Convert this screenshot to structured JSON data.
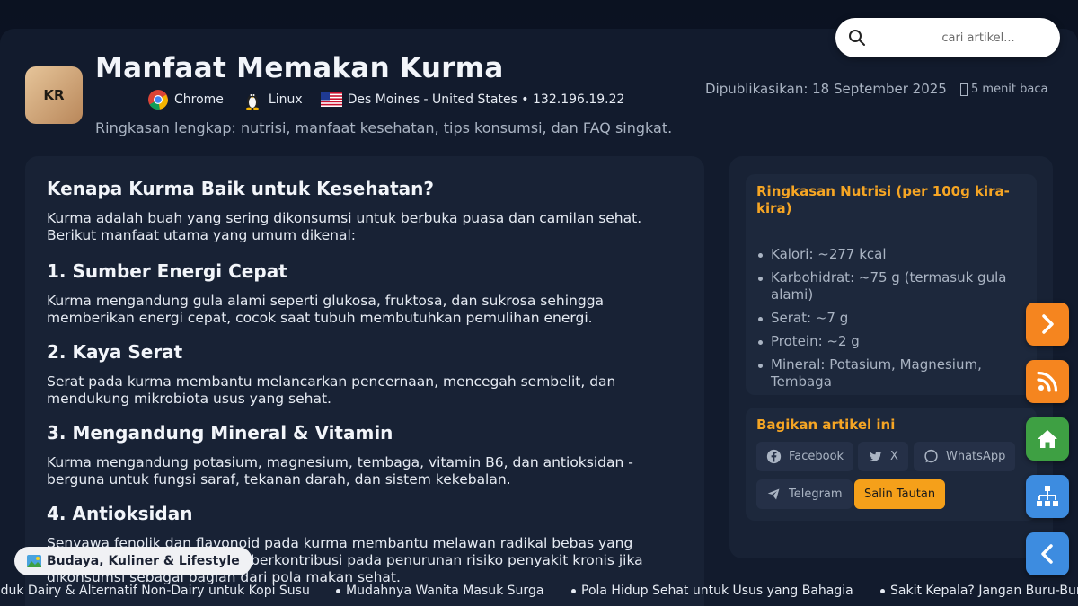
{
  "search": {
    "placeholder": "cari artikel..."
  },
  "header": {
    "logo_text": "KR",
    "title": "Manfaat Memakan Kurma",
    "browser": "Chrome",
    "os": "Linux",
    "location": "Des Moines - United States • 132.196.19.22",
    "subtitle": "Ringkasan lengkap: nutrisi, manfaat kesehatan, tips konsumsi, dan FAQ singkat.",
    "published": "Dipublikasikan: 18 September 2025",
    "read_time": "5 menit baca"
  },
  "article": {
    "heading": "Kenapa Kurma Baik untuk Kesehatan?",
    "intro": "Kurma adalah buah yang sering dikonsumsi untuk berbuka puasa dan camilan sehat. Berikut manfaat utama yang umum dikenal:",
    "sections": [
      {
        "title": "1. Sumber Energi Cepat",
        "body": "Kurma mengandung gula alami seperti glukosa, fruktosa, dan sukrosa sehingga memberikan energi cepat, cocok saat tubuh membutuhkan pemulihan energi."
      },
      {
        "title": "2. Kaya Serat",
        "body": "Serat pada kurma membantu melancarkan pencernaan, mencegah sembelit, dan mendukung mikrobiota usus yang sehat."
      },
      {
        "title": "3. Mengandung Mineral & Vitamin",
        "body": "Kurma mengandung potasium, magnesium, tembaga, vitamin B6, dan antioksidan - berguna untuk fungsi saraf, tekanan darah, dan sistem kekebalan."
      },
      {
        "title": "4. Antioksidan",
        "body": "Senyawa fenolik dan flavonoid pada kurma membantu melawan radikal bebas yang dapat merusak sel. Ini dapat berkontribusi pada penurunan risiko penyakit kronis jika dikonsumsi sebagai bagian dari pola makan sehat."
      }
    ]
  },
  "sidebar": {
    "nutrition": {
      "title": "Ringkasan Nutrisi (per 100g kira-kira)",
      "items": [
        "Kalori: ~277 kcal",
        "Karbohidrat: ~75 g (termasuk gula alami)",
        "Serat: ~7 g",
        "Protein: ~2 g",
        "Mineral: Potasium, Magnesium, Tembaga"
      ]
    },
    "share": {
      "title": "Bagikan artikel ini",
      "facebook": "Facebook",
      "x": "X",
      "whatsapp": "WhatsApp",
      "telegram": "Telegram",
      "copy": "Salin Tautan"
    }
  },
  "category_pill": "Budaya, Kuliner & Lifestyle",
  "ticker": [
    "oduk Dairy & Alternatif Non-Dairy untuk Kopi Susu",
    "Mudahnya Wanita Masuk Surga",
    "Pola Hidup Sehat untuk Usus yang Bahagia",
    "Sakit Kepala? Jangan Buru-Buru"
  ],
  "colors": {
    "accent": "#f5a524",
    "background": "#121b2d",
    "fab_orange": "#f5851f",
    "fab_green": "#3ea043",
    "fab_blue": "#3d8ce0"
  },
  "icons": [
    "search-icon",
    "chrome-icon",
    "linux-icon",
    "us-flag-icon",
    "clock-icon",
    "facebook-icon",
    "twitter-icon",
    "whatsapp-icon",
    "telegram-icon",
    "chevron-right-icon",
    "rss-icon",
    "home-icon",
    "sitemap-icon",
    "chevron-left-icon",
    "landscape-icon"
  ]
}
